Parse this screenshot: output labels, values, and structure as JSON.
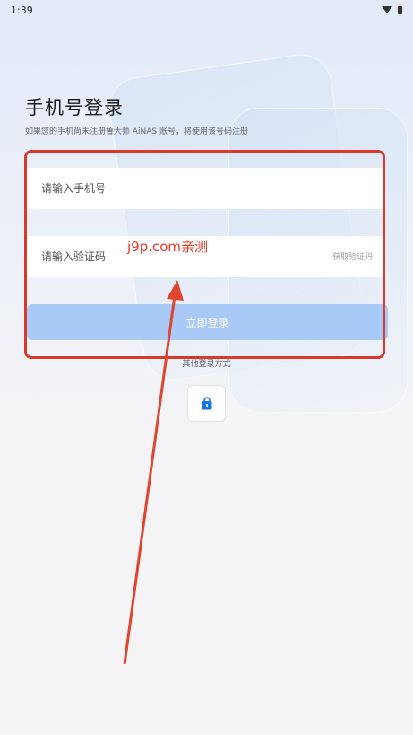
{
  "status_bar": {
    "time": "1:39",
    "wifi_icon": "wifi-icon",
    "battery_icon": "battery-icon"
  },
  "login": {
    "title": "手机号登录",
    "subtitle": "如果您的手机尚未注册鲁大师 AiNAS 账号，将使用该号码注册",
    "phone_placeholder": "请输入手机号",
    "code_placeholder": "请输入验证码",
    "get_code_label": "获取验证码",
    "submit_label": "立即登录",
    "other_methods_label": "其他登录方式",
    "alt_login_icon": "lock-bag-icon"
  },
  "annotation": {
    "watermark": "j9p.com亲测",
    "color": "#d9392b"
  },
  "colors": {
    "accent": "#a9c9f7",
    "icon_blue": "#1a73e8"
  }
}
